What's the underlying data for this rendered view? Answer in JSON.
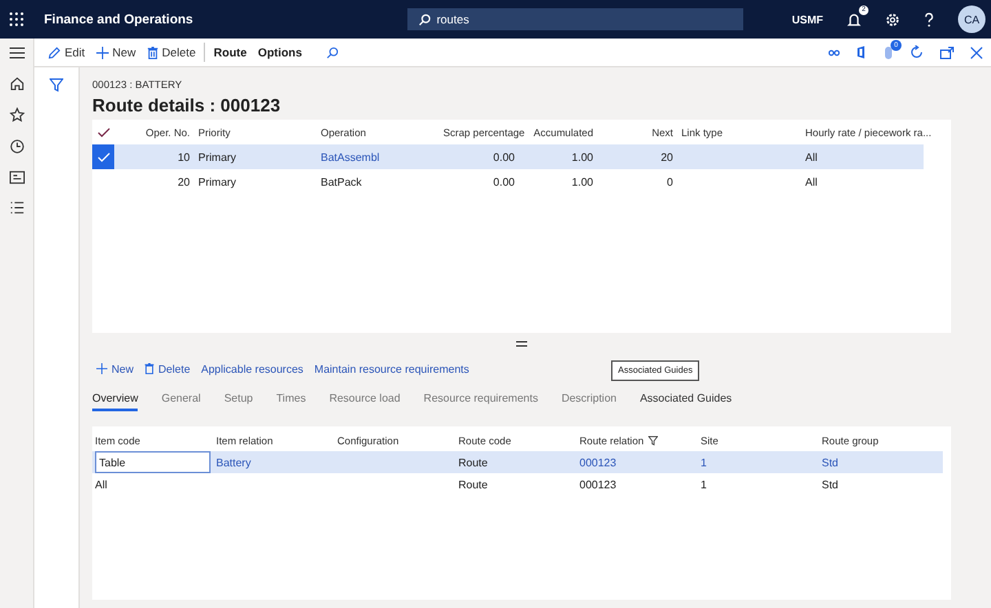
{
  "app": {
    "title": "Finance and Operations",
    "company": "USMF",
    "notification_count": "2",
    "avatar": "CA"
  },
  "search": {
    "value": "routes"
  },
  "action_pane": {
    "buttons": [
      {
        "label": "Edit",
        "kind": "edit"
      },
      {
        "label": "New",
        "kind": "new"
      },
      {
        "label": "Delete",
        "kind": "delete"
      },
      {
        "label": "Route",
        "kind": "text"
      },
      {
        "label": "Options",
        "kind": "text"
      }
    ],
    "attachments_count": "0"
  },
  "breadcrumb": "000123 : BATTERY",
  "title": "Route details : 000123",
  "operations": {
    "columns": [
      "Oper. No.",
      "Priority",
      "Operation",
      "Scrap percentage",
      "Accumulated",
      "Next",
      "Link type",
      "Hourly rate / piecework ra..."
    ],
    "rows": [
      {
        "selected": true,
        "cells": [
          {
            "text": "10",
            "link": false
          },
          {
            "text": "Primary",
            "link": false
          },
          {
            "text": "BatAssembl",
            "link": true
          },
          {
            "text": "0.00",
            "link": false
          },
          {
            "text": "1.00",
            "link": false
          },
          {
            "text": "20",
            "link": false
          },
          null,
          {
            "text": "All",
            "link": false
          }
        ]
      },
      {
        "selected": false,
        "cells": [
          "20",
          "Primary",
          "BatPack",
          "0.00",
          "1.00",
          "0",
          null,
          "All"
        ]
      }
    ]
  },
  "resource_actions": [
    {
      "label": "New",
      "kind": "new"
    },
    {
      "label": "Delete",
      "kind": "delete"
    },
    {
      "label": "Applicable resources",
      "kind": "text"
    },
    {
      "label": "Maintain resource requirements",
      "kind": "text"
    }
  ],
  "tabs": [
    {
      "label": "Overview",
      "selected": true
    },
    {
      "label": "General",
      "selected": false
    },
    {
      "label": "Setup",
      "selected": false
    },
    {
      "label": "Times",
      "selected": false
    },
    {
      "label": "Resource load",
      "selected": false
    },
    {
      "label": "Resource requirements",
      "selected": false
    },
    {
      "label": "Description",
      "selected": false
    },
    {
      "label": "Associated Guides",
      "selected": false
    }
  ],
  "tooltip": "Associated Guides",
  "relations": {
    "columns": [
      {
        "label": "Item code",
        "filtered": false
      },
      {
        "label": "Item relation",
        "filtered": false
      },
      {
        "label": "Configuration",
        "filtered": false
      },
      {
        "label": "Route code",
        "filtered": false
      },
      {
        "label": "Route relation",
        "filtered": true
      },
      {
        "label": "Site",
        "filtered": false
      },
      {
        "label": "Route group",
        "filtered": false
      }
    ],
    "rows": [
      {
        "selected": true,
        "cells": [
          {
            "text": "Table",
            "link": false
          },
          {
            "text": "Battery",
            "link": true
          },
          null,
          {
            "text": "Route",
            "link": false
          },
          {
            "text": "000123",
            "link": true
          },
          {
            "text": "1",
            "link": true
          },
          {
            "text": "Std",
            "link": true
          }
        ]
      },
      {
        "selected": false,
        "cells": [
          "All",
          null,
          null,
          "Route",
          "000123",
          "1",
          "Std"
        ]
      }
    ]
  }
}
